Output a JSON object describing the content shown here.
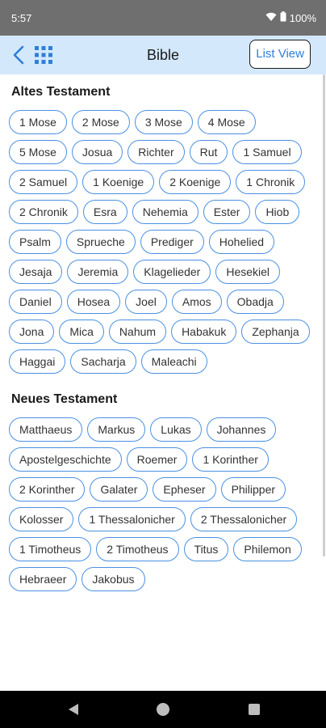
{
  "status_bar": {
    "time": "5:57",
    "battery": "100%",
    "icons": [
      "wifi-icon",
      "battery-icon"
    ]
  },
  "app_bar": {
    "title": "Bible",
    "list_view_label": "List View",
    "icons": [
      "back-arrow-icon",
      "grid-icon"
    ]
  },
  "colors": {
    "accent": "#4a90e2",
    "app_bar_bg": "#d4e8fc",
    "status_bar_bg": "#6f6f6f"
  },
  "old_testament": {
    "title": "Altes Testament",
    "books": [
      "1 Mose",
      "2 Mose",
      "3 Mose",
      "4 Mose",
      "5 Mose",
      "Josua",
      "Richter",
      "Rut",
      "1 Samuel",
      "2 Samuel",
      "1 Koenige",
      "2 Koenige",
      "1 Chronik",
      "2 Chronik",
      "Esra",
      "Nehemia",
      "Ester",
      "Hiob",
      "Psalm",
      "Sprueche",
      "Prediger",
      "Hohelied",
      "Jesaja",
      "Jeremia",
      "Klagelieder",
      "Hesekiel",
      "Daniel",
      "Hosea",
      "Joel",
      "Amos",
      "Obadja",
      "Jona",
      "Mica",
      "Nahum",
      "Habakuk",
      "Zephanja",
      "Haggai",
      "Sacharja",
      "Maleachi"
    ]
  },
  "new_testament": {
    "title": "Neues Testament",
    "books": [
      "Matthaeus",
      "Markus",
      "Lukas",
      "Johannes",
      "Apostelgeschichte",
      "Roemer",
      "1 Korinther",
      "2 Korinther",
      "Galater",
      "Epheser",
      "Philipper",
      "Kolosser",
      "1 Thessalonicher",
      "2 Thessalonicher",
      "1 Timotheus",
      "2 Timotheus",
      "Titus",
      "Philemon",
      "Hebraeer",
      "Jakobus"
    ]
  },
  "nav_bar": {
    "icons": [
      "back-triangle-icon",
      "home-circle-icon",
      "recents-square-icon"
    ]
  }
}
